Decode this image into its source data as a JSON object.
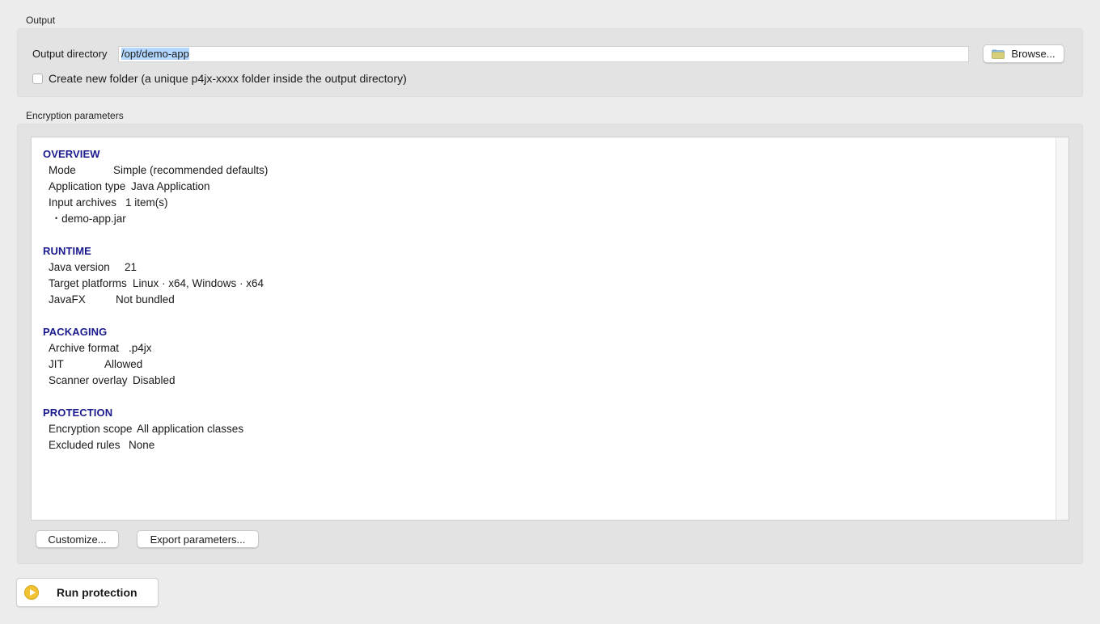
{
  "output": {
    "section_title": "Output",
    "dir_label": "Output directory",
    "dir_value": "/opt/demo-app",
    "browse_label": "Browse...",
    "create_folder_label": "Create new folder (a unique p4jx-xxxx folder inside the output directory)",
    "create_folder_checked": false
  },
  "encryption": {
    "section_title": "Encryption parameters",
    "overview": {
      "heading": "OVERVIEW",
      "rows": [
        {
          "key": "Mode",
          "value": "Simple (recommended defaults)"
        },
        {
          "key": "Application type",
          "value": "Java Application"
        },
        {
          "key": "Input archives",
          "value": "1 item(s)"
        }
      ],
      "items": [
        "demo-app.jar"
      ]
    },
    "runtime": {
      "heading": "RUNTIME",
      "rows": [
        {
          "key": "Java version",
          "value": "21"
        },
        {
          "key": "Target platforms",
          "value": "Linux · x64, Windows · x64"
        },
        {
          "key": "JavaFX",
          "value": "Not bundled"
        }
      ]
    },
    "packaging": {
      "heading": "PACKAGING",
      "rows": [
        {
          "key": "Archive format",
          "value": ".p4jx"
        },
        {
          "key": "JIT",
          "value": "Allowed"
        },
        {
          "key": "Scanner overlay",
          "value": "Disabled"
        }
      ]
    },
    "protection": {
      "heading": "PROTECTION",
      "rows": [
        {
          "key": "Encryption scope",
          "value": "All application classes"
        },
        {
          "key": "Excluded rules",
          "value": "None"
        }
      ]
    },
    "customize_label": "Customize...",
    "export_label": "Export parameters..."
  },
  "run": {
    "label": "Run protection"
  },
  "colors": {
    "section_heading": "#1a1a8c",
    "selection": "#b3d7ff",
    "run_icon": "#f1c232"
  },
  "icons": {
    "browse": "folder-icon",
    "run": "play-icon"
  }
}
